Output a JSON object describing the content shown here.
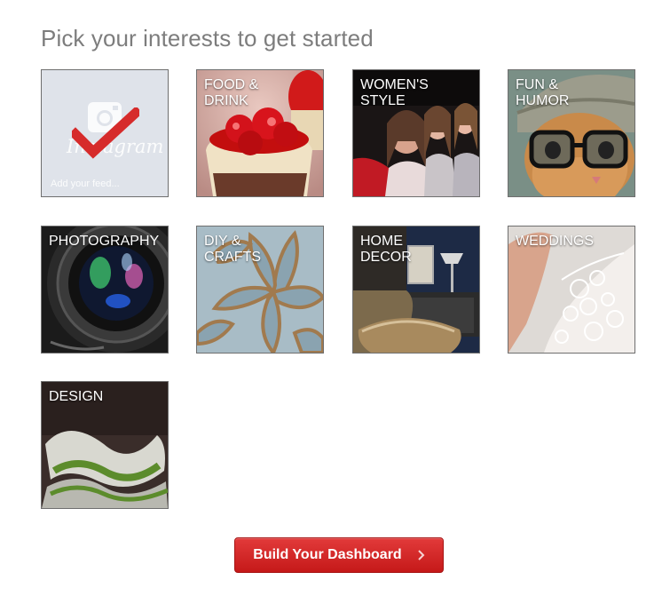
{
  "page": {
    "title": "Pick your interests to get started"
  },
  "tiles": [
    {
      "label": "",
      "feed_text": "Add your feed...",
      "brand_text": "Instagram",
      "selected": true
    },
    {
      "label": "FOOD &\nDRINK"
    },
    {
      "label": "WOMEN'S\nSTYLE"
    },
    {
      "label": "FUN &\nHUMOR"
    },
    {
      "label": "PHOTOGRAPHY"
    },
    {
      "label": "DIY &\nCRAFTS"
    },
    {
      "label": "HOME\nDECOR"
    },
    {
      "label": "WEDDINGS"
    },
    {
      "label": "DESIGN"
    }
  ],
  "button": {
    "label": "Build Your Dashboard",
    "icon": "chevron-right-icon"
  },
  "colors": {
    "accent": "#d32424",
    "checkmark": "#d62b2b",
    "title_text": "#7d7d7d"
  }
}
